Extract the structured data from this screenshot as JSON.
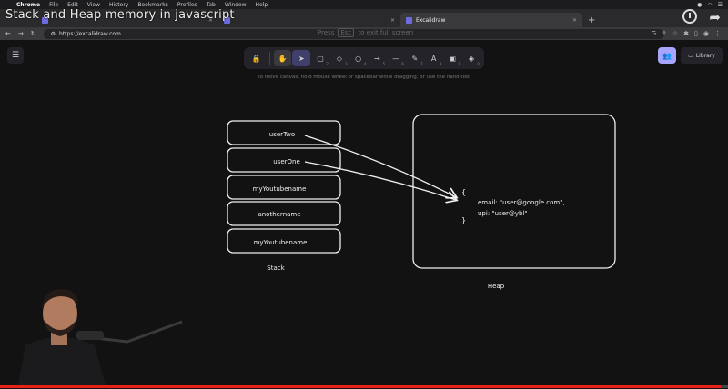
{
  "video": {
    "title": "Stack and Heap memory in javascript",
    "progress": 0.99
  },
  "menubar": {
    "items": [
      "Chrome",
      "File",
      "Edit",
      "View",
      "History",
      "Bookmarks",
      "Profiles",
      "Tab",
      "Window",
      "Help"
    ]
  },
  "browser": {
    "tabs": [
      {
        "label": ""
      },
      {
        "label": ""
      },
      {
        "label": "Excalidraw"
      }
    ],
    "url": "https://excalidraw.com",
    "fullscreen_hint": {
      "prefix": "Press",
      "key": "Esc",
      "suffix": "to exit full screen"
    }
  },
  "excalidraw": {
    "library_label": "Library",
    "canvas_hint": "To move canvas, hold mouse wheel or spacebar while dragging, or use the hand tool",
    "tools": [
      {
        "name": "lock",
        "glyph": "🔒",
        "num": ""
      },
      {
        "name": "hand",
        "glyph": "✋",
        "num": ""
      },
      {
        "name": "selection",
        "glyph": "➤",
        "num": "1"
      },
      {
        "name": "rectangle",
        "glyph": "▢",
        "num": "2"
      },
      {
        "name": "diamond",
        "glyph": "◇",
        "num": "3"
      },
      {
        "name": "ellipse",
        "glyph": "○",
        "num": "4"
      },
      {
        "name": "arrow",
        "glyph": "→",
        "num": "5"
      },
      {
        "name": "line",
        "glyph": "—",
        "num": "6"
      },
      {
        "name": "draw",
        "glyph": "✎",
        "num": "7"
      },
      {
        "name": "text",
        "glyph": "A",
        "num": "8"
      },
      {
        "name": "image",
        "glyph": "▣",
        "num": "9"
      },
      {
        "name": "eraser",
        "glyph": "◈",
        "num": "0"
      }
    ]
  },
  "diagram": {
    "stack_items": [
      "userTwo",
      "userOne",
      "myYoutubename",
      "anothername",
      "myYoutubename"
    ],
    "stack_label": "Stack",
    "heap_label": "Heap",
    "heap_open": "{",
    "heap_line1": "email: \"user@google.com\",",
    "heap_line2": "upi: \"user@ybl\"",
    "heap_close": "}"
  }
}
